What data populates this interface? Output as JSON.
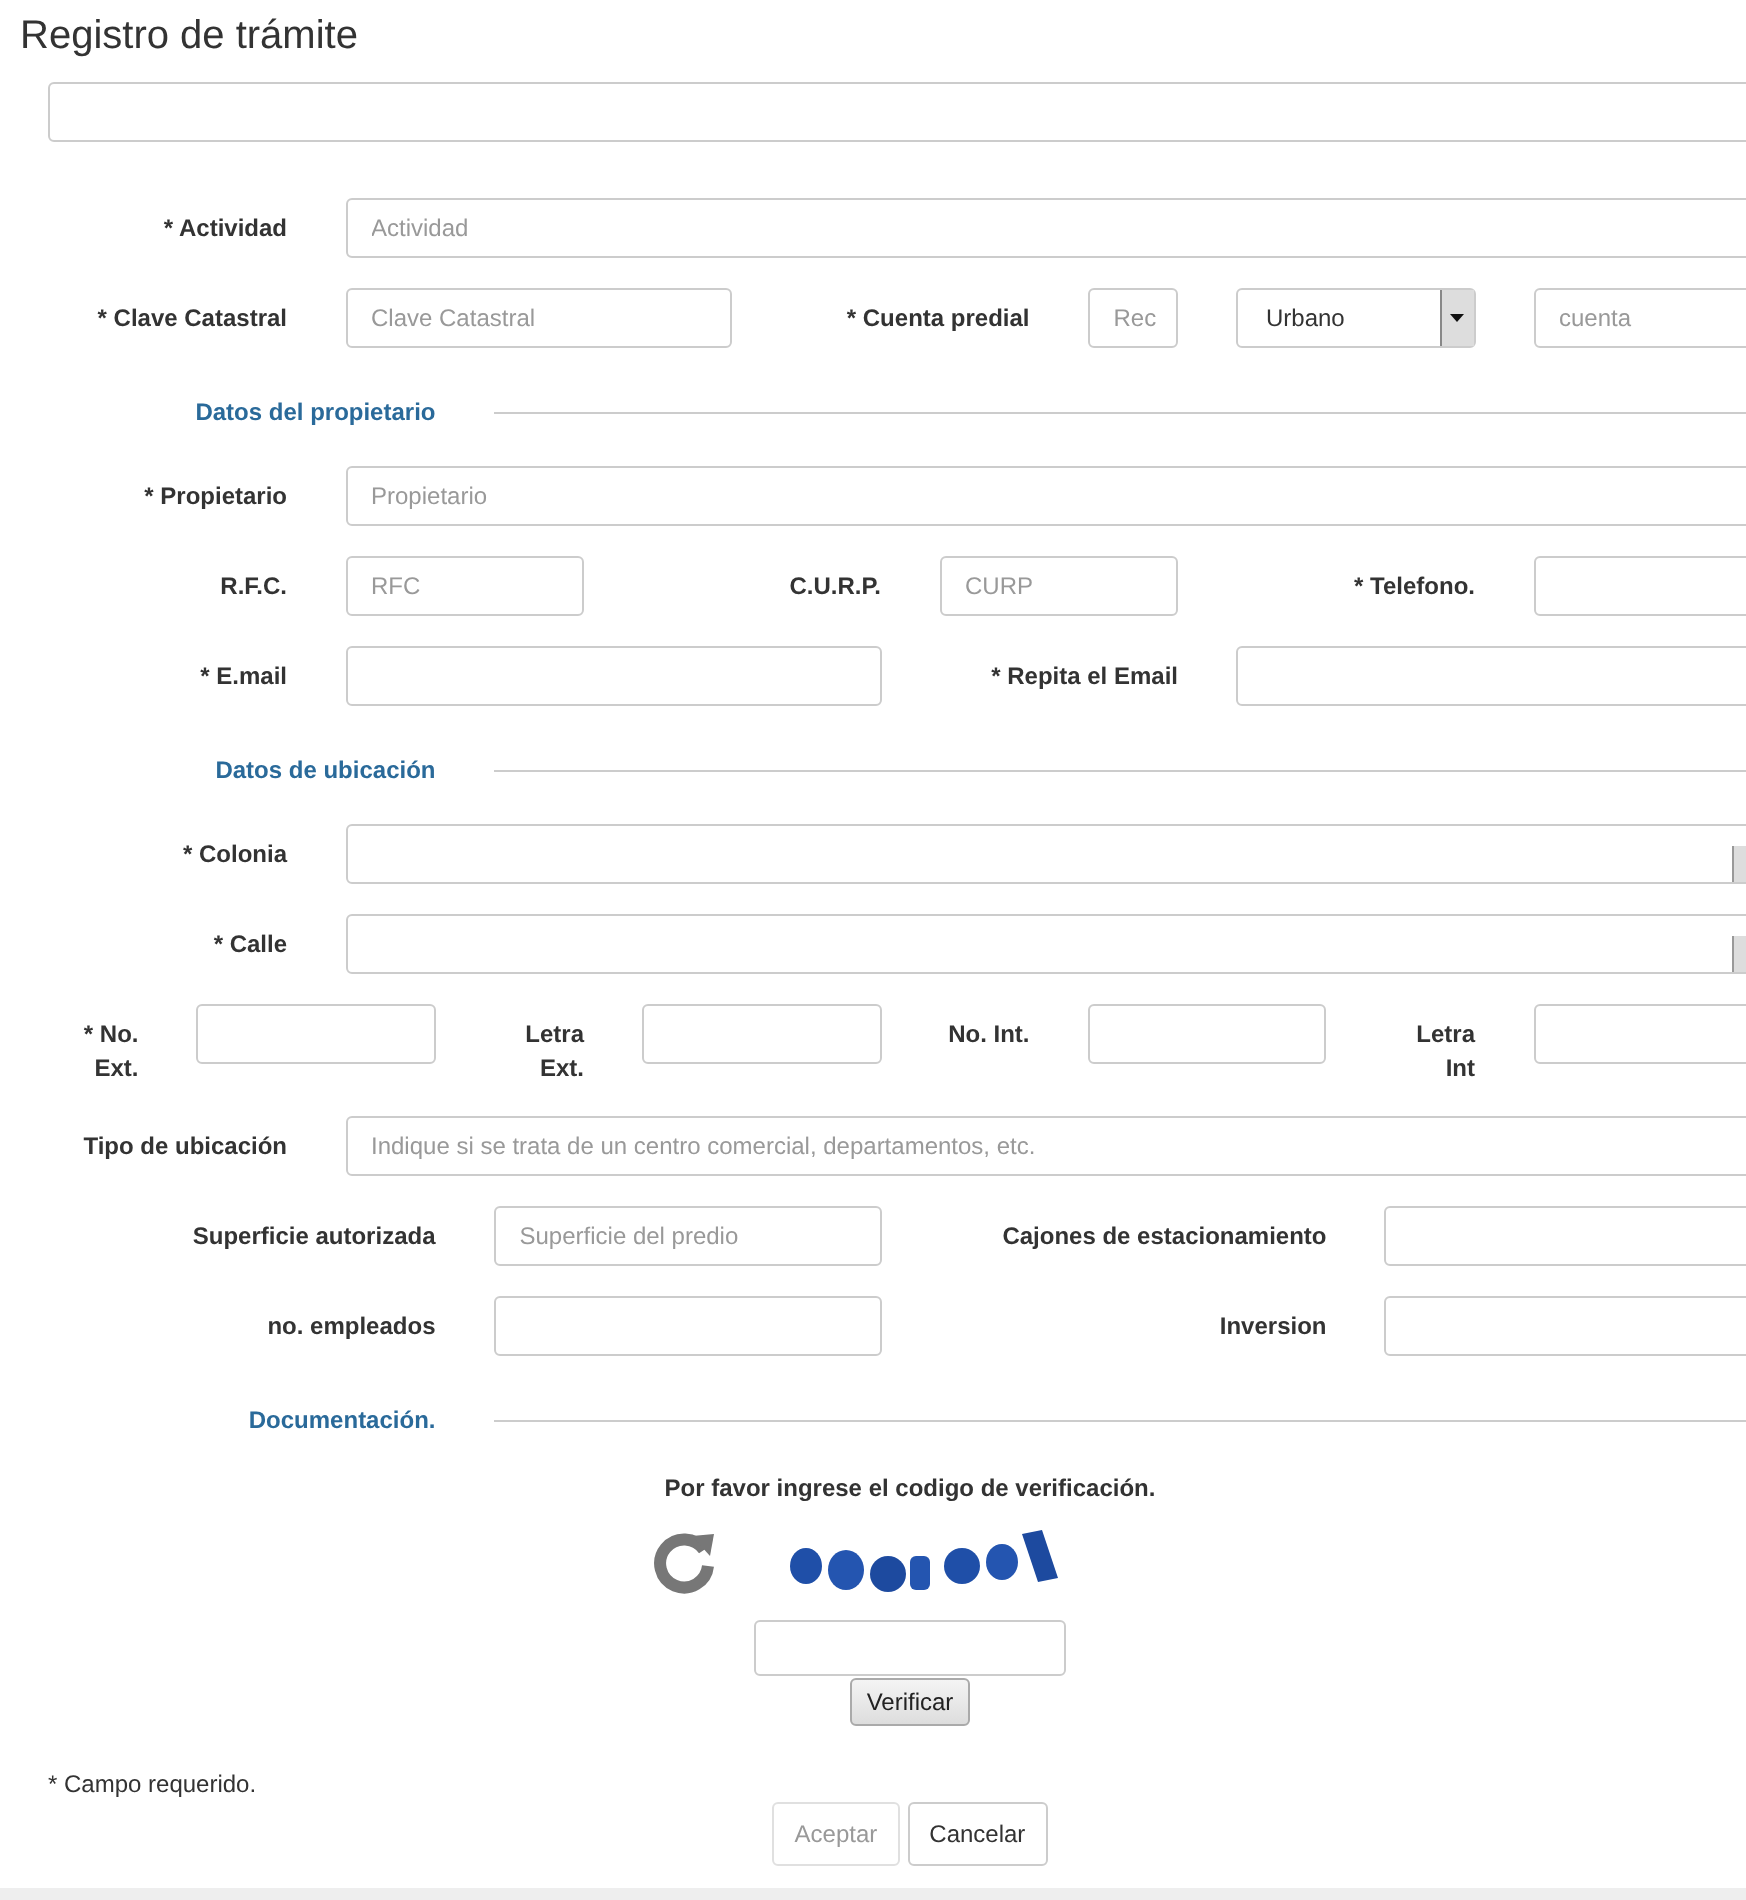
{
  "title": "Registro de trámite",
  "top_field": {
    "kind": "combo"
  },
  "rows": [
    {
      "kind": "full",
      "items": [
        {
          "kind": "label",
          "text": "* Actividad"
        },
        {
          "kind": "input",
          "placeholder": "Actividad"
        }
      ]
    },
    {
      "kind": "cadastral",
      "items": [
        {
          "kind": "label",
          "text": "* Clave Catastral"
        },
        {
          "kind": "input",
          "placeholder": "Clave Catastral"
        },
        {
          "kind": "label",
          "text": "* Cuenta predial"
        },
        {
          "kind": "input",
          "placeholder": "Rec"
        },
        {
          "kind": "dropdown",
          "value": "Urbano"
        },
        {
          "kind": "input",
          "placeholder": "cuenta"
        }
      ]
    },
    {
      "kind": "section",
      "title": "Datos del propietario"
    },
    {
      "kind": "full",
      "items": [
        {
          "kind": "label",
          "text": "* Propietario"
        },
        {
          "kind": "input",
          "placeholder": "Propietario"
        }
      ]
    },
    {
      "kind": "triple",
      "items": [
        {
          "kind": "label",
          "text": "R.F.C."
        },
        {
          "kind": "input",
          "placeholder": "RFC"
        },
        {
          "kind": "label",
          "text": "C.U.R.P."
        },
        {
          "kind": "input",
          "placeholder": "CURP"
        },
        {
          "kind": "label",
          "text": "* Telefono."
        },
        {
          "kind": "input"
        }
      ]
    },
    {
      "kind": "double",
      "items": [
        {
          "kind": "label",
          "text": "* E.mail"
        },
        {
          "kind": "input"
        },
        {
          "kind": "label",
          "text": "* Repita el Email"
        },
        {
          "kind": "input"
        }
      ]
    },
    {
      "kind": "section",
      "title": "Datos de ubicación"
    },
    {
      "kind": "full",
      "items": [
        {
          "kind": "label",
          "text": "* Colonia"
        },
        {
          "kind": "combo"
        }
      ]
    },
    {
      "kind": "full",
      "items": [
        {
          "kind": "label",
          "text": "* Calle"
        },
        {
          "kind": "combo"
        }
      ]
    },
    {
      "kind": "quad",
      "items": [
        {
          "kind": "label",
          "text": "* No. Ext."
        },
        {
          "kind": "input"
        },
        {
          "kind": "label",
          "text": "Letra Ext."
        },
        {
          "kind": "input"
        },
        {
          "kind": "label",
          "text": "No. Int."
        },
        {
          "kind": "input"
        },
        {
          "kind": "label",
          "text": "Letra Int"
        },
        {
          "kind": "input"
        }
      ]
    },
    {
      "kind": "full",
      "items": [
        {
          "kind": "label",
          "text": "Tipo de ubicación"
        },
        {
          "kind": "input",
          "placeholder": "Indique si se trata de un centro comercial, departamentos, etc."
        }
      ]
    },
    {
      "kind": "wide",
      "items": [
        {
          "kind": "label",
          "text": "Superficie autorizada"
        },
        {
          "kind": "input",
          "placeholder": "Superficie del predio"
        },
        {
          "kind": "label",
          "text": "Cajones de estacionamiento"
        },
        {
          "kind": "input"
        }
      ]
    },
    {
      "kind": "wide",
      "items": [
        {
          "kind": "label",
          "text": "no. empleados"
        },
        {
          "kind": "input"
        },
        {
          "kind": "label",
          "text": "Inversion"
        },
        {
          "kind": "input"
        }
      ]
    },
    {
      "kind": "section",
      "title": "Documentación."
    }
  ],
  "captcha": {
    "prompt": "Por favor ingrese el codigo de verificación.",
    "button": "Verificar"
  },
  "footnote": "* Campo requerido.",
  "actions": [
    {
      "label": "Aceptar",
      "disabled": true
    },
    {
      "label": "Cancelar",
      "disabled": false
    }
  ]
}
